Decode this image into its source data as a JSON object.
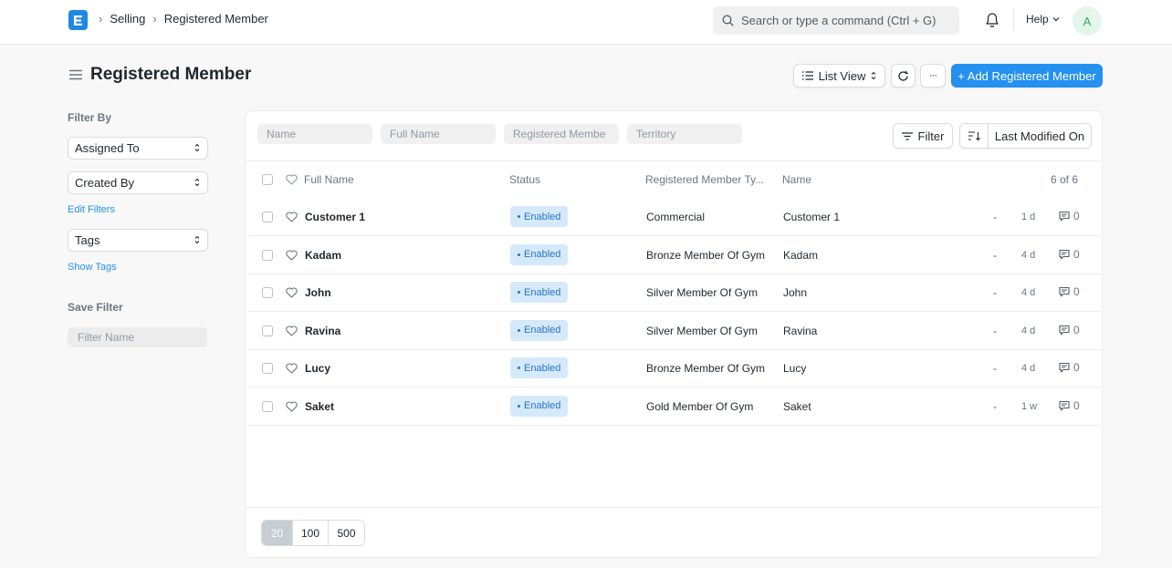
{
  "navbar": {
    "breadcrumbs": [
      "Selling",
      "Registered Member"
    ],
    "search_placeholder": "Search or type a command (Ctrl + G)",
    "help_label": "Help",
    "avatar_initial": "A"
  },
  "page": {
    "title": "Registered Member",
    "list_view_label": "List View",
    "more_label": "···",
    "add_button_label": "+ Add Registered Member"
  },
  "sidebar": {
    "filter_by_label": "Filter By",
    "assigned_to": "Assigned To",
    "created_by": "Created By",
    "edit_filters": "Edit Filters",
    "tags": "Tags",
    "show_tags": "Show Tags",
    "save_filter_label": "Save Filter",
    "filter_name_placeholder": "Filter Name"
  },
  "filters": {
    "name_placeholder": "Name",
    "full_name_placeholder": "Full Name",
    "registered_member_placeholder": "Registered Membe",
    "territory_placeholder": "Territory",
    "filter_button": "Filter",
    "sort_label": "Last Modified On"
  },
  "table": {
    "headers": {
      "full_name": "Full Name",
      "status": "Status",
      "type": "Registered Member Ty...",
      "name": "Name",
      "count": "6 of 6"
    },
    "rows": [
      {
        "full_name": "Customer 1",
        "status": "Enabled",
        "type": "Commercial",
        "name": "Customer 1",
        "dash": "-",
        "modified": "1 d",
        "comments": "0"
      },
      {
        "full_name": "Kadam",
        "status": "Enabled",
        "type": "Bronze Member Of Gym",
        "name": "Kadam",
        "dash": "-",
        "modified": "4 d",
        "comments": "0"
      },
      {
        "full_name": "John",
        "status": "Enabled",
        "type": "Silver Member Of Gym",
        "name": "John",
        "dash": "-",
        "modified": "4 d",
        "comments": "0"
      },
      {
        "full_name": "Ravina",
        "status": "Enabled",
        "type": "Silver Member Of Gym",
        "name": "Ravina",
        "dash": "-",
        "modified": "4 d",
        "comments": "0"
      },
      {
        "full_name": "Lucy",
        "status": "Enabled",
        "type": "Bronze Member Of Gym",
        "name": "Lucy",
        "dash": "-",
        "modified": "4 d",
        "comments": "0"
      },
      {
        "full_name": "Saket",
        "status": "Enabled",
        "type": "Gold Member Of Gym",
        "name": "Saket",
        "dash": "-",
        "modified": "1 w",
        "comments": "0"
      }
    ]
  },
  "paging": {
    "sizes": [
      "20",
      "100",
      "500"
    ]
  },
  "colors": {
    "primary": "#2490ef",
    "badge_bg": "#d5e9fb",
    "badge_text": "#2476c3"
  }
}
